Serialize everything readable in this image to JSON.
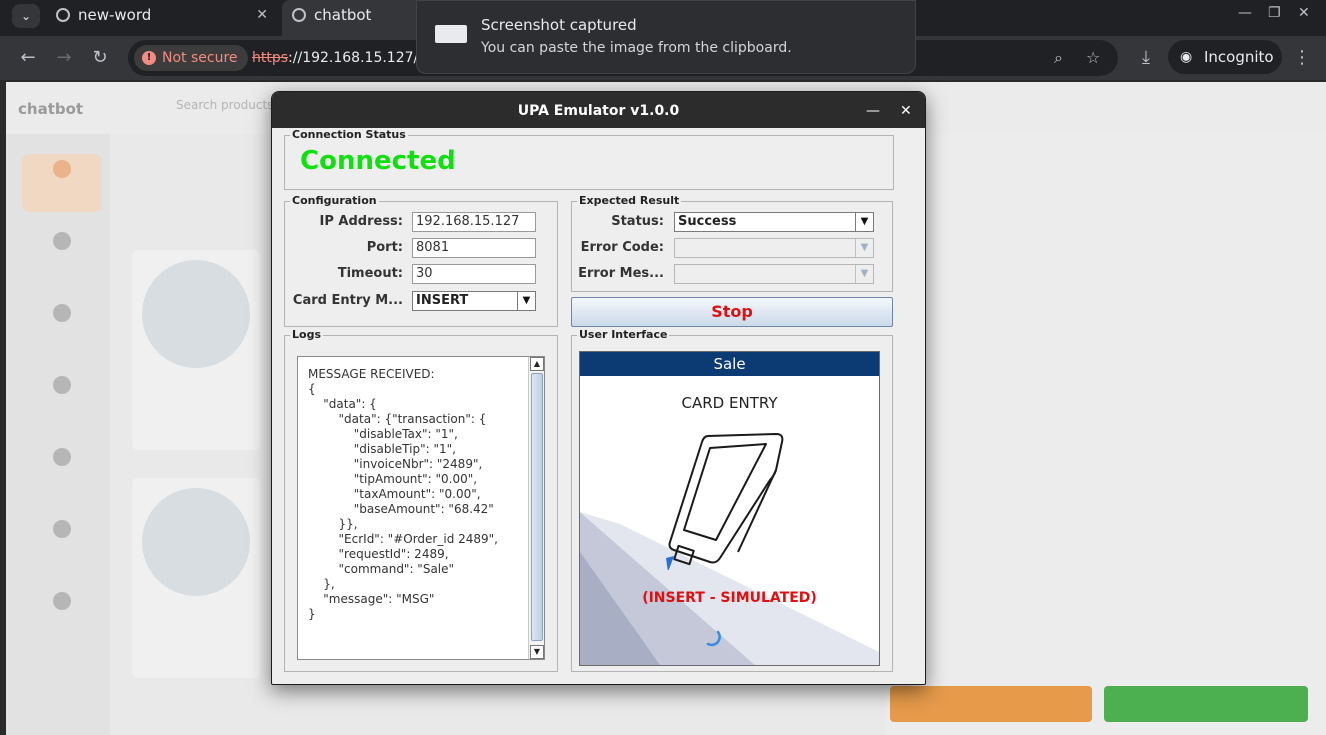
{
  "browser": {
    "tabs": [
      {
        "label": "new-word",
        "active": false
      },
      {
        "label": "chatbot",
        "active": true
      }
    ],
    "security_label": "Not secure",
    "url_scheme": "https",
    "url_rest": "://192.168.15.127/ch",
    "incognito_label": "Incognito"
  },
  "notification": {
    "title": "Screenshot captured",
    "message": "You can paste the image from the clipboard."
  },
  "page": {
    "brand": "chatbot",
    "search_placeholder": "Search products"
  },
  "emulator": {
    "title": "UPA Emulator v1.0.0",
    "connection_group": "Connection Status",
    "connection_status": "Connected",
    "configuration_group": "Configuration",
    "ip_label": "IP Address:",
    "ip_value": "192.168.15.127",
    "port_label": "Port:",
    "port_value": "8081",
    "timeout_label": "Timeout:",
    "timeout_value": "30",
    "card_entry_label": "Card Entry M...",
    "card_entry_value": "INSERT",
    "expected_group": "Expected Result",
    "status_label": "Status:",
    "status_value": "Success",
    "error_code_label": "Error Code:",
    "error_code_value": "",
    "error_msg_label": "Error Mes...",
    "error_msg_value": "",
    "stop_label": "Stop",
    "logs_group": "Logs",
    "log_text": "MESSAGE RECEIVED:\n{\n    \"data\": {\n        \"data\": {\"transaction\": {\n            \"disableTax\": \"1\",\n            \"disableTip\": \"1\",\n            \"invoiceNbr\": \"2489\",\n            \"tipAmount\": \"0.00\",\n            \"taxAmount\": \"0.00\",\n            \"baseAmount\": \"68.42\"\n        }},\n        \"EcrId\": \"#Order_id 2489\",\n        \"requestId\": 2489,\n        \"command\": \"Sale\"\n    },\n    \"message\": \"MSG\"\n}",
    "ui_group": "User Interface",
    "screen_header": "Sale",
    "screen_prompt": "CARD ENTRY",
    "screen_status": "(INSERT - SIMULATED)"
  },
  "colors": {
    "connected": "#10e010",
    "stop_text": "#e01010",
    "screen_header_bg": "#0c3b74"
  }
}
